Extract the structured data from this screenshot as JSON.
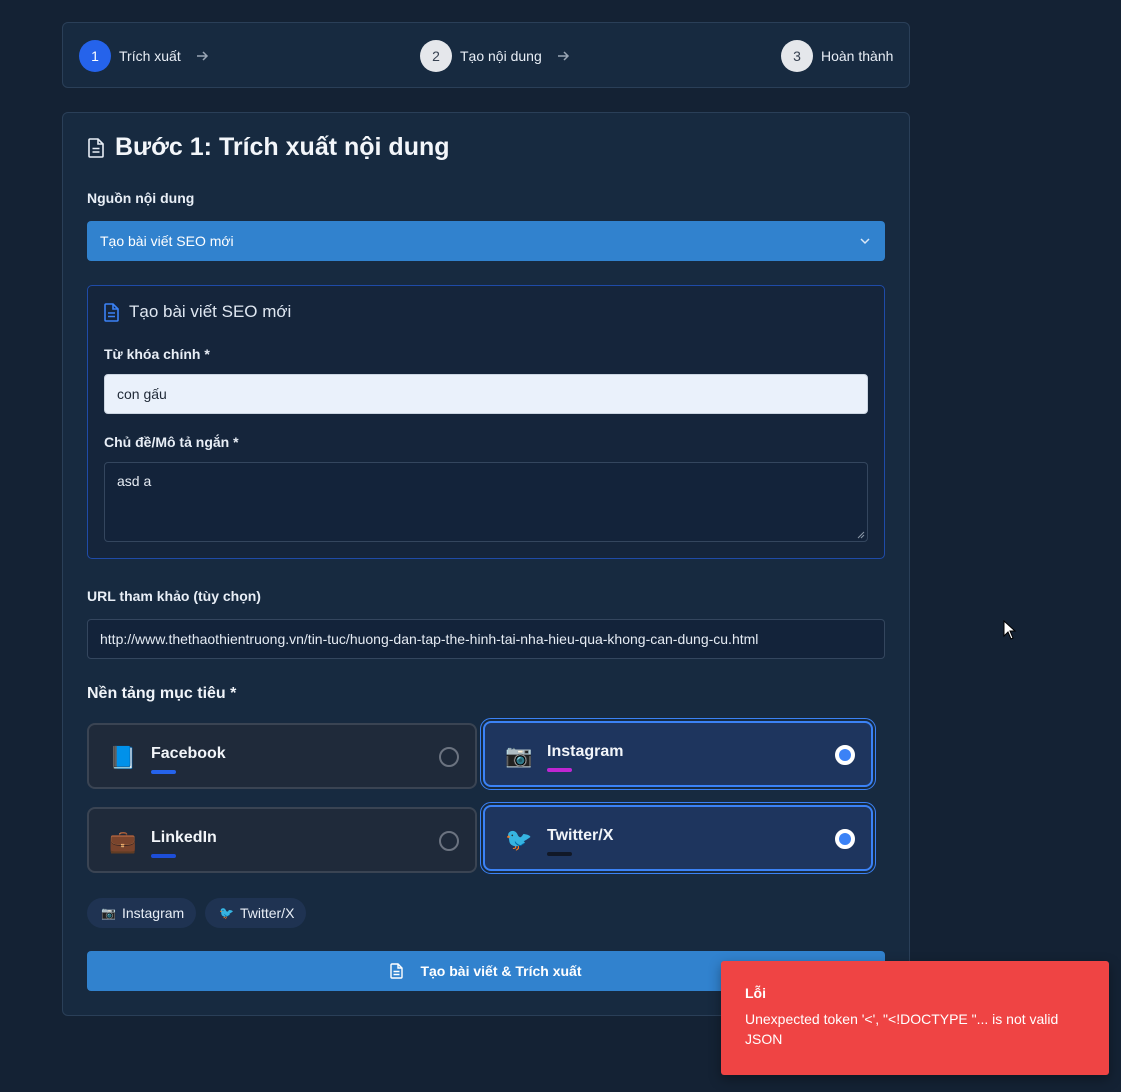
{
  "steps": [
    {
      "number": "1",
      "label": "Trích xuất",
      "active": true
    },
    {
      "number": "2",
      "label": "Tạo nội dung",
      "active": false
    },
    {
      "number": "3",
      "label": "Hoàn thành",
      "active": false
    }
  ],
  "card": {
    "title": "Bước 1: Trích xuất nội dung",
    "source_label": "Nguồn nội dung",
    "source_value": "Tạo bài viết SEO mới"
  },
  "seo": {
    "title": "Tạo bài viết SEO mới",
    "keyword_label": "Từ khóa chính *",
    "keyword_value": "con gấu",
    "topic_label": "Chủ đề/Mô tả ngắn *",
    "topic_value": "asd a"
  },
  "url": {
    "label": "URL tham khảo (tùy chọn)",
    "value": "http://www.thethaothientruong.vn/tin-tuc/huong-dan-tap-the-hinh-tai-nha-hieu-qua-khong-can-dung-cu.html"
  },
  "platforms": {
    "title": "Nền tảng mục tiêu *",
    "items": [
      {
        "name": "Facebook",
        "icon": "📘",
        "icon_name": "book-icon",
        "bar_color": "#2563eb",
        "selected": false
      },
      {
        "name": "Instagram",
        "icon": "📷",
        "icon_name": "camera-icon",
        "bar_color": "#c026d3",
        "selected": true
      },
      {
        "name": "LinkedIn",
        "icon": "💼",
        "icon_name": "briefcase-icon",
        "bar_color": "#1d4ed8",
        "selected": false
      },
      {
        "name": "Twitter/X",
        "icon": "🐦",
        "icon_name": "bird-icon",
        "bar_color": "#111827",
        "selected": true
      }
    ]
  },
  "chips": [
    {
      "icon": "📷",
      "label": "Instagram"
    },
    {
      "icon": "🐦",
      "label": "Twitter/X"
    }
  ],
  "submit_label": "Tạo bài viết & Trích xuất",
  "toast": {
    "title": "Lỗi",
    "message": "Unexpected token '<', \"<!DOCTYPE \"... is not valid JSON"
  },
  "colors": {
    "accent": "#3182ce",
    "error": "#ef4444",
    "active_step": "#2563eb"
  }
}
